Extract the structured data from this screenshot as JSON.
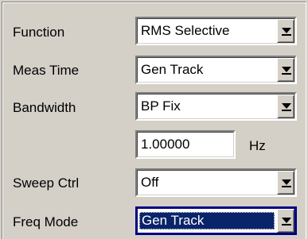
{
  "rows": {
    "function": {
      "label": "Function",
      "value": "RMS Selective"
    },
    "meas_time": {
      "label": "Meas Time",
      "value": "Gen Track"
    },
    "bandwidth": {
      "label": "Bandwidth",
      "value": "BP Fix"
    },
    "freq_value": {
      "value": "1.00000",
      "unit": "Hz"
    },
    "sweep_ctrl": {
      "label": "Sweep Ctrl",
      "value": "Off"
    },
    "freq_mode": {
      "label": "Freq Mode",
      "value": "Gen Track"
    }
  },
  "icons": {
    "dropdown": "chevron-down-icon"
  },
  "colors": {
    "panel_bg": "#d4d0c8",
    "selection_bg": "#0a246a",
    "focus_border": "#000080"
  }
}
